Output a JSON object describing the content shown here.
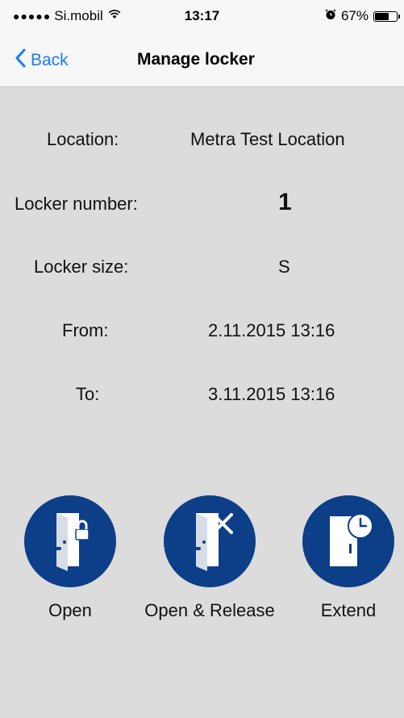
{
  "status_bar": {
    "signal_dots": "●●●●●",
    "carrier": "Si.mobil",
    "time": "13:17",
    "battery_percent": "67%",
    "battery_level": 0.67
  },
  "nav": {
    "back_label": "Back",
    "title": "Manage locker"
  },
  "details": {
    "location_label": "Location:",
    "location_value": "Metra Test Location",
    "number_label": "Locker number:",
    "number_value": "1",
    "size_label": "Locker size:",
    "size_value": "S",
    "from_label": "From:",
    "from_value": "2.11.2015 13:16",
    "to_label": "To:",
    "to_value": "3.11.2015 13:16"
  },
  "actions": {
    "open_label": "Open",
    "open_release_label": "Open & Release",
    "extend_label": "Extend"
  },
  "colors": {
    "accent": "#1a7cf6",
    "button_bg": "#0d3f88",
    "background": "#dcdcdc"
  }
}
